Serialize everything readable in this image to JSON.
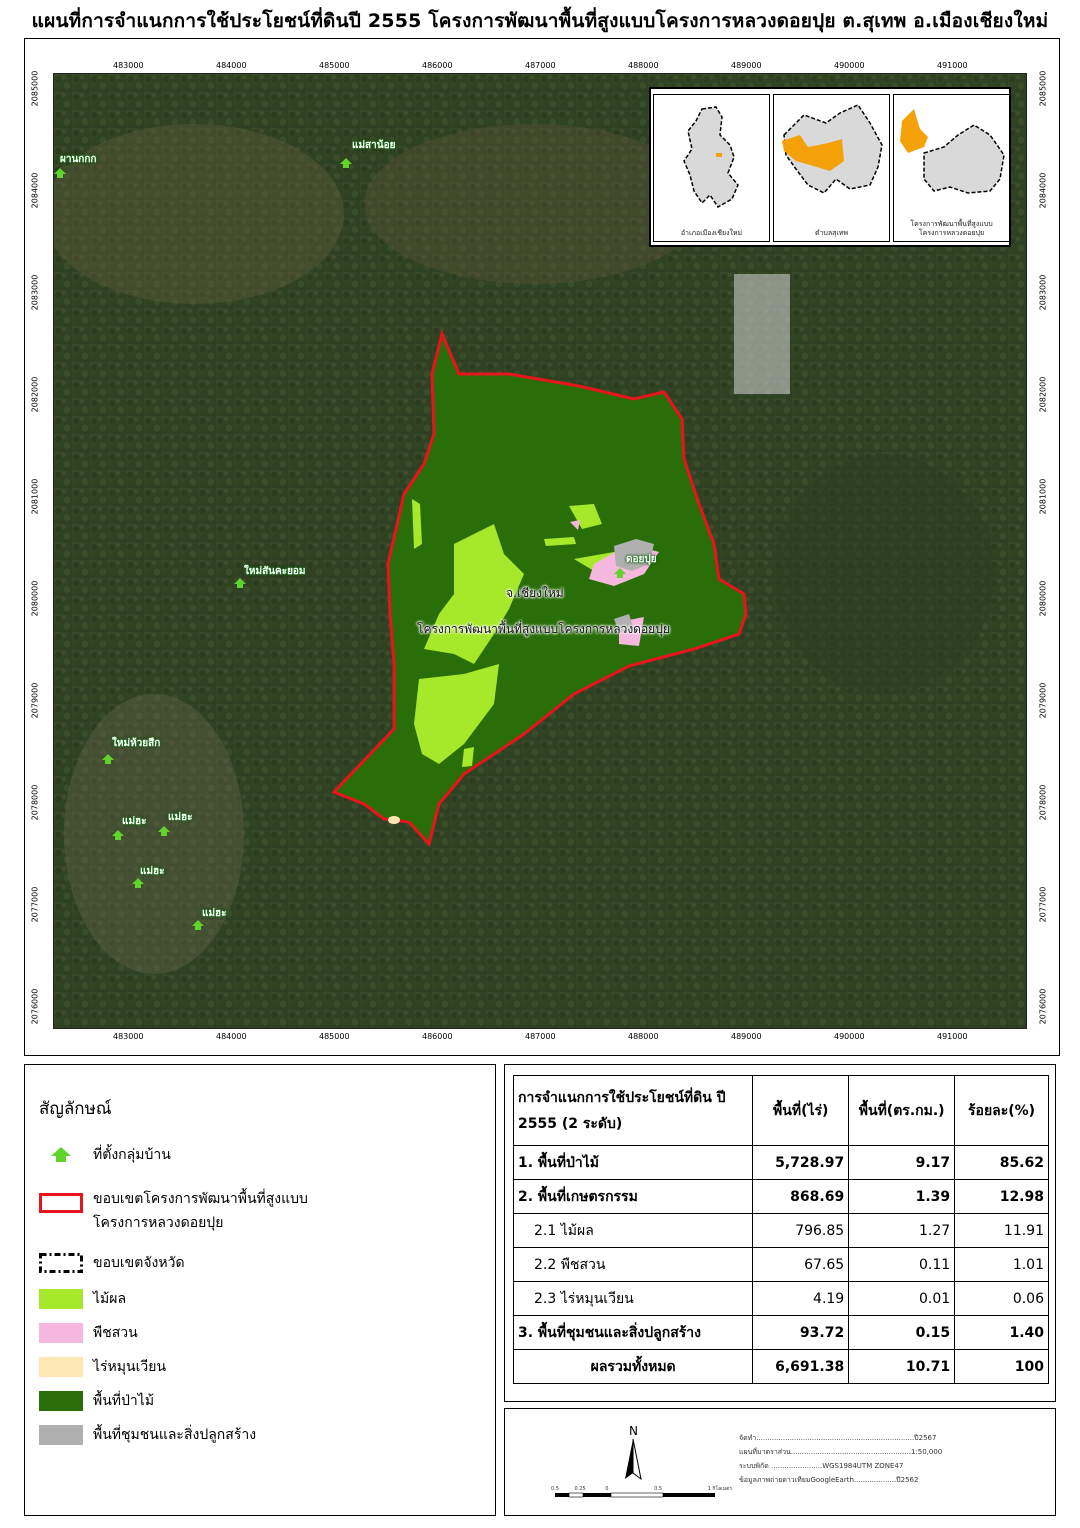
{
  "title": "แผนที่การจำแนกการใช้ประโยชน์ที่ดินปี 2555 โครงการพัฒนาพื้นที่สูงแบบโครงการหลวงดอยปุย ต.สุเทพ อ.เมืองเชียงใหม่ จ.เชียงใหม่",
  "map": {
    "x_ticks": [
      "483000",
      "484000",
      "485000",
      "486000",
      "487000",
      "488000",
      "489000",
      "490000",
      "491000"
    ],
    "y_ticks": [
      "2085000",
      "2084000",
      "2083000",
      "2082000",
      "2081000",
      "2080000",
      "2079000",
      "2078000",
      "2077000",
      "2076000"
    ],
    "villages": [
      "ผานกกก",
      "แม่สาน้อย",
      "ใหม่สันคะยอม",
      "ใหม่ห้วยสีก",
      "แม่ฮะ",
      "แม่ฮะ",
      "แม่ฮะ",
      "แม่ฮะ",
      "ดอยปุย"
    ],
    "province_label": "จ.เชียงใหม่",
    "project_label": "โครงการพัฒนาพื้นที่สูงแบบโครงการหลวงดอยปุย"
  },
  "insets": [
    {
      "caption": "อำเภอเมืองเชียงใหม่"
    },
    {
      "caption": "ตำบลสุเทพ"
    },
    {
      "caption": "โครงการพัฒนาพื้นที่สูงแบบ\nโครงการหลวงดอยปุย"
    }
  ],
  "legend": {
    "title": "สัญลักษณ์",
    "items": [
      {
        "label": "ที่ตั้งกลุ่มบ้าน",
        "symbol": "village-icon",
        "color": "#5fd42a"
      },
      {
        "label": "ขอบเขตโครงการพัฒนาพื้นที่สูงแบบ",
        "label2": "โครงการหลวงดอยปุย",
        "symbol": "red-boundary",
        "color": "#e8141b"
      },
      {
        "label": "ขอบเขตจังหวัด",
        "symbol": "dashed-boundary",
        "color": "#000000"
      },
      {
        "label": "ไม้ผล",
        "symbol": "fill",
        "color": "#a6e82a"
      },
      {
        "label": "พืชสวน",
        "symbol": "fill",
        "color": "#f7b8df"
      },
      {
        "label": "ไร่หมุนเวียน",
        "symbol": "fill",
        "color": "#fde8b4"
      },
      {
        "label": "พื้นที่ป่าไม้",
        "symbol": "fill",
        "color": "#2a6e0a"
      },
      {
        "label": "พื้นที่ชุมชนและสิ่งปลูกสร้าง",
        "symbol": "fill",
        "color": "#b0b0b0"
      }
    ]
  },
  "table": {
    "headers": [
      "การจำแนกการใช้ประโยชน์ที่ดิน ปี 2555 (2 ระดับ)",
      "พื้นที่(ไร่)",
      "พื้นที่(ตร.กม.)",
      "ร้อยละ(%)"
    ],
    "rows": [
      {
        "name": "1. พื้นที่ป่าไม้",
        "rai": "5,728.97",
        "sqkm": "9.17",
        "pct": "85.62"
      },
      {
        "name": "2. พื้นที่เกษตรกรรม",
        "rai": "868.69",
        "sqkm": "1.39",
        "pct": "12.98"
      },
      {
        "name": "2.1 ไม้ผล",
        "rai": "796.85",
        "sqkm": "1.27",
        "pct": "11.91"
      },
      {
        "name": "2.2 พืชสวน",
        "rai": "67.65",
        "sqkm": "0.11",
        "pct": "1.01"
      },
      {
        "name": "2.3 ไร่หมุนเวียน",
        "rai": "4.19",
        "sqkm": "0.01",
        "pct": "0.06"
      },
      {
        "name": "3. พื้นที่ชุมชนและสิ่งปลูกสร้าง",
        "rai": "93.72",
        "sqkm": "0.15",
        "pct": "1.40"
      },
      {
        "name": "ผลรวมทั้งหมด",
        "rai": "6,691.38",
        "sqkm": "10.71",
        "pct": "100"
      }
    ]
  },
  "credits": {
    "north": "N",
    "scale_labels": [
      "0.5",
      "0.25",
      "0",
      "0.5",
      "1 กิโลเมตร"
    ],
    "lines": [
      "จัดทำ.......................................................................ปี2567",
      "แผนที่มาตราส่วน......................................................1:50,000",
      "ระบบพิกัด .......................WGS1984UTM ZONE47",
      "ข้อมูลภาพถ่ายดาวเทียมGoogleEarth...................ปี2562"
    ]
  }
}
